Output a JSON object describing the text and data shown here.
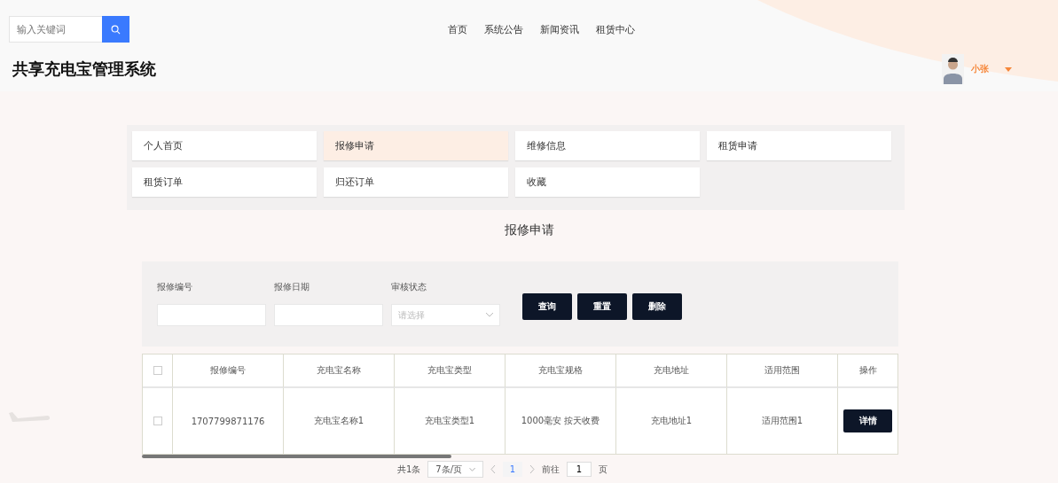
{
  "header": {
    "search": {
      "placeholder": "输入关键词"
    },
    "nav": [
      "首页",
      "系统公告",
      "新闻资讯",
      "租赁中心"
    ],
    "title": "共享充电宝管理系统",
    "user": {
      "name": "小张"
    }
  },
  "menu": [
    {
      "label": "个人首页",
      "selected": false
    },
    {
      "label": "报修申请",
      "selected": true
    },
    {
      "label": "维修信息",
      "selected": false
    },
    {
      "label": "租赁申请",
      "selected": false
    },
    {
      "label": "租赁订单",
      "selected": false
    },
    {
      "label": "归还订单",
      "selected": false
    },
    {
      "label": "收藏",
      "selected": false
    }
  ],
  "page_title": "报修申请",
  "filters": [
    {
      "label": "报修编号",
      "kind": "text"
    },
    {
      "label": "报修日期",
      "kind": "text"
    },
    {
      "label": "审核状态",
      "kind": "select",
      "placeholder": "请选择"
    }
  ],
  "buttons": [
    "查询",
    "重置",
    "删除"
  ],
  "table": {
    "all_checked": false,
    "columns": [
      "报修编号",
      "充电宝名称",
      "充电宝类型",
      "充电宝规格",
      "充电地址",
      "适用范围"
    ],
    "action_column": "操作",
    "rows": [
      {
        "checked": false,
        "cells": [
          "1707799871176",
          "充电宝名称1",
          "充电宝类型1",
          "1000毫安 按天收费",
          "充电地址1",
          "适用范围1"
        ],
        "action": "详情"
      }
    ]
  },
  "pagination": {
    "total": "共1条",
    "page_size": "7条/页",
    "pages": [
      {
        "label": "1",
        "selected": true
      }
    ],
    "goto_label": "前往",
    "goto_value": "1",
    "goto_suffix": "页"
  }
}
